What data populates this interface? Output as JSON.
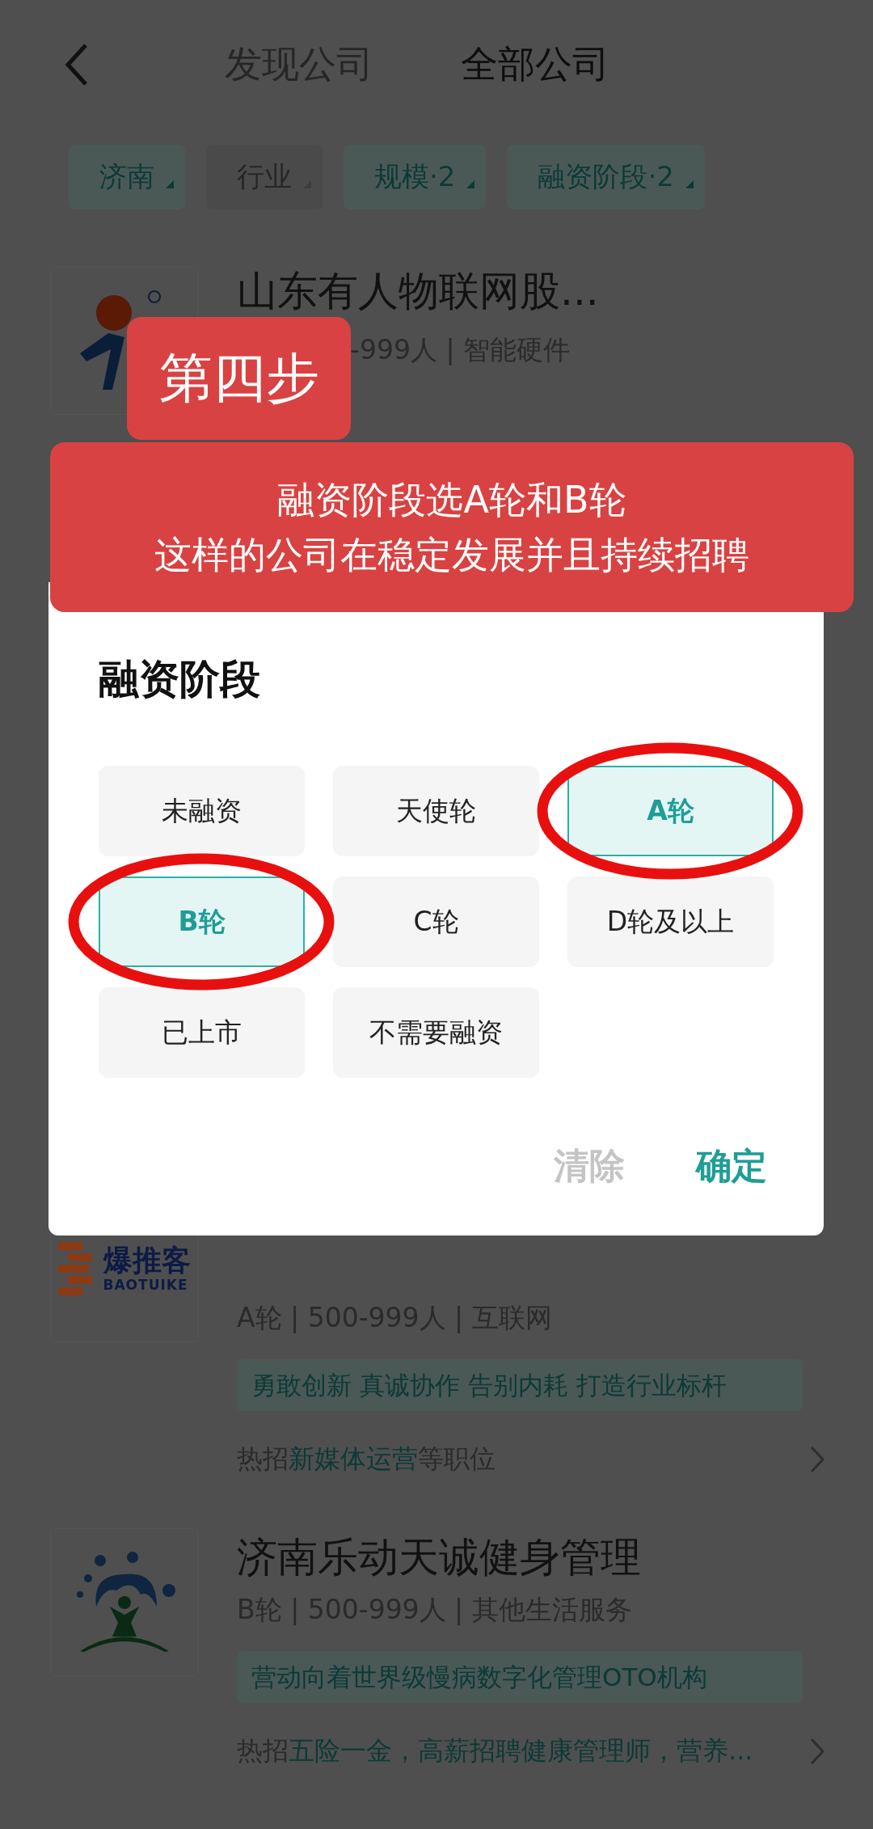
{
  "header": {
    "tabs": [
      {
        "label": "发现公司",
        "selected": false
      },
      {
        "label": "全部公司",
        "selected": true
      }
    ]
  },
  "filters": [
    {
      "label": "济南",
      "selected": true
    },
    {
      "label": "行业",
      "selected": false
    },
    {
      "label": "规模·2",
      "selected": true
    },
    {
      "label": "融资阶段·2",
      "selected": true
    }
  ],
  "companies": [
    {
      "kind": "person",
      "name": "山东有人物联网股...",
      "info": "-999人 | 智能硬件"
    },
    {
      "kind": "bricks",
      "logo_text": "爆推客",
      "logo_subtext": "BAOTUIKE",
      "info": "A轮 | 500-999人 | 互联网",
      "tag": "勇敢创新 真诚协作 告别内耗 打造行业标杆",
      "hire": {
        "prefix": "热招",
        "highlight": "新媒体运营",
        "suffix": "等职位"
      }
    },
    {
      "kind": "tree",
      "name": "济南乐动天诚健身管理",
      "info": "B轮 | 500-999人 | 其他生活服务",
      "tag": "营动向着世界级慢病数字化管理OTO机构",
      "hire": {
        "prefix": "热招",
        "highlight": "五险一金，高薪招聘健康管理师，营养..."
      }
    }
  ],
  "step_badge": "第四步",
  "banner": [
    "融资阶段选A轮和B轮",
    "这样的公司在稳定发展并且持续招聘"
  ],
  "dialog": {
    "title": "融资阶段",
    "options": [
      {
        "label": "未融资",
        "selected": false,
        "circled": false
      },
      {
        "label": "天使轮",
        "selected": false,
        "circled": false
      },
      {
        "label": "A轮",
        "selected": true,
        "circled": true
      },
      {
        "label": "B轮",
        "selected": true,
        "circled": true
      },
      {
        "label": "C轮",
        "selected": false,
        "circled": false
      },
      {
        "label": "D轮及以上",
        "selected": false,
        "circled": false
      },
      {
        "label": "已上市",
        "selected": false,
        "circled": false
      },
      {
        "label": "不需要融资",
        "selected": false,
        "circled": false
      }
    ],
    "buttons": [
      {
        "label": "清除",
        "kind": "secondary"
      },
      {
        "label": "确定",
        "kind": "primary"
      }
    ]
  }
}
